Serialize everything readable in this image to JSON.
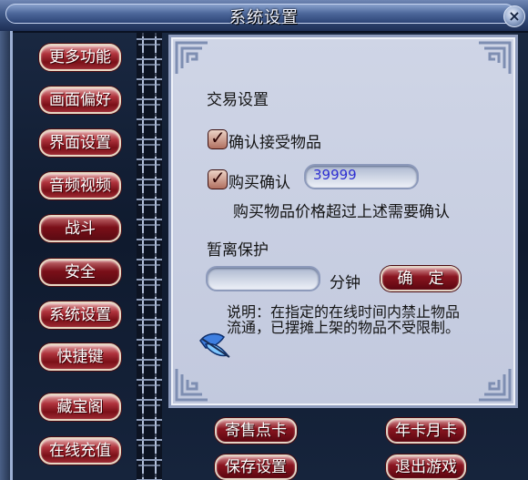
{
  "window": {
    "title": "系统设置"
  },
  "sidebar": {
    "items": [
      {
        "label": "更多功能"
      },
      {
        "label": "画面偏好"
      },
      {
        "label": "界面设置"
      },
      {
        "label": "音频视频"
      },
      {
        "label": "战斗"
      },
      {
        "label": "安全"
      },
      {
        "label": "系统设置"
      },
      {
        "label": "快捷键"
      },
      {
        "label": "藏宝阁"
      },
      {
        "label": "在线充值"
      }
    ]
  },
  "panel": {
    "trade_section_title": "交易设置",
    "confirm_receive": {
      "label": "确认接受物品",
      "checked": true
    },
    "buy_confirm": {
      "label": "购买确认",
      "checked": true,
      "value": "39999"
    },
    "buy_hint": "购买物品价格超过上述需要确认",
    "away_section_title": "暂离保护",
    "away_minutes": {
      "value": "",
      "unit": "分钟"
    },
    "confirm_button": "确　定",
    "note": "说明：在指定的在线时间内禁止物品流通，已摆摊上架的物品不受限制。"
  },
  "footer": {
    "consign_card": "寄售点卡",
    "annual_card": "年卡月卡",
    "save_settings": "保存设置",
    "exit_game": "退出游戏"
  },
  "colors": {
    "button_red": "#8a1520",
    "panel_bg": "#c9cfe2",
    "input_text": "#2e2fd2"
  }
}
